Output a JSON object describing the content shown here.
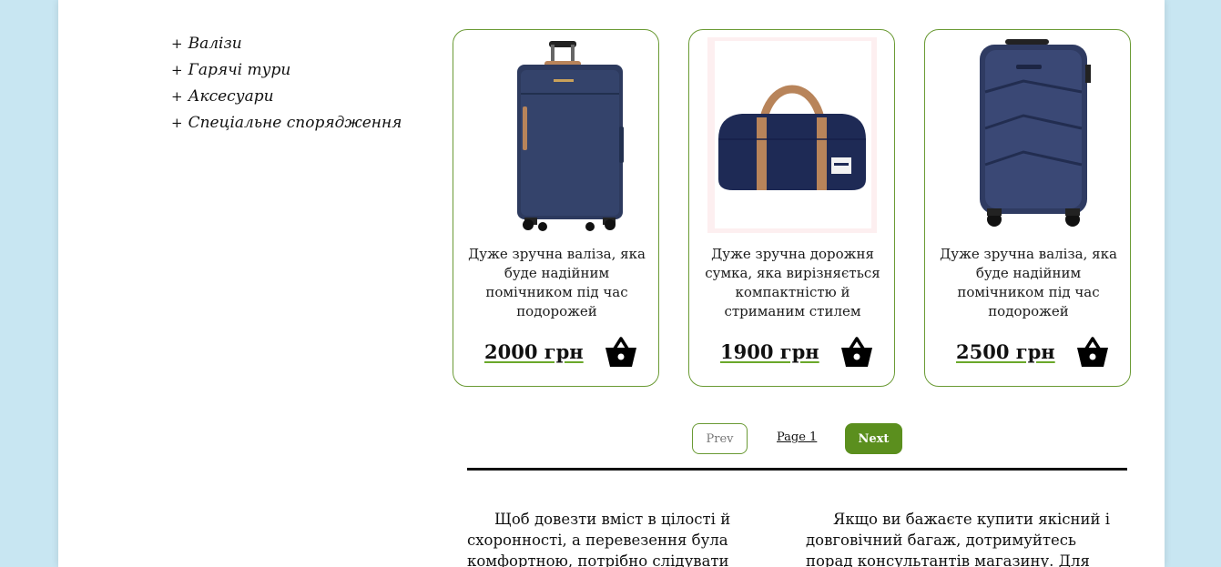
{
  "sidebar": {
    "items": [
      {
        "label": "Валізи"
      },
      {
        "label": "Гарячі тури"
      },
      {
        "label": "Аксесуари"
      },
      {
        "label": "Спеціальне спорядження"
      }
    ]
  },
  "products": [
    {
      "image": "navy-soft-suitcase-image",
      "description": "Дуже зручна валіза, яка буде надійним помічником під час подорожей",
      "price": "2000 грн"
    },
    {
      "image": "navy-duffel-bag-image",
      "description": "Дуже зручна дорожня сумка, яка вирізняється компактністю й стриманим стилем",
      "price": "1900 грн"
    },
    {
      "image": "navy-hardshell-suitcase-image",
      "description": "Дуже зручна валіза, яка буде надійним помічником під час подорожей",
      "price": "2500 грн"
    }
  ],
  "pagination": {
    "prev_label": "Prev",
    "page_label": "Page 1",
    "next_label": "Next"
  },
  "article": {
    "left_text": "Щоб довезти вміст в цілості й схоронності, а перевезення була комфортною, потрібно слідувати",
    "right_text": "Якщо ви бажаєте купити якісний і довговічний багаж, дотримуйтесь порад консультантів магазину. Для"
  },
  "colors": {
    "background": "#c8e6f2",
    "accent_green": "#5b8f1e",
    "card_border": "#6a9a34",
    "luggage_navy": "#2d3a5e",
    "strap_tan": "#b8845a"
  }
}
